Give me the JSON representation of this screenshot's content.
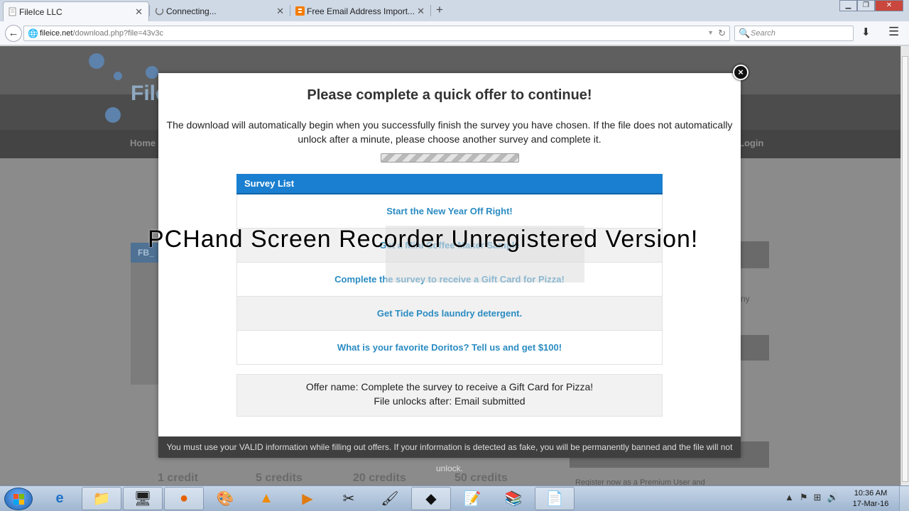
{
  "browser": {
    "tabs": [
      {
        "title": "FileIce LLC",
        "active": true
      },
      {
        "title": "Connecting...",
        "active": false
      },
      {
        "title": "Free Email Address Import...",
        "active": false
      }
    ],
    "new_tab_glyph": "+",
    "url_host": "fileice.net",
    "url_path": "/download.php?file=43v3c",
    "search_placeholder": "Search",
    "window_controls": [
      "minimize-icon",
      "restore-icon",
      "close-icon"
    ]
  },
  "page_behind": {
    "logo_text": "File",
    "nav_home": "Home",
    "nav_login": "Login",
    "tab_label": "FB_",
    "side_text": "ny",
    "register_text": "Register now as a Premium User and",
    "credits": [
      "1 credit",
      "5 credits",
      "20 credits",
      "50 credits"
    ]
  },
  "modal": {
    "title": "Please complete a quick offer to continue!",
    "description": "The download will automatically begin when you successfully finish the survey you have chosen. If the file does not automatically unlock after a minute, please choose another survey and complete it.",
    "progress_state": "indeterminate",
    "survey_list_title": "Survey List",
    "surveys": [
      "Start the New Year Off Right!",
      "Get a Mini Coffee Maker Sample",
      "Complete the survey to receive a Gift Card for Pizza!",
      "Get Tide Pods laundry detergent.",
      "What is your favorite Doritos? Tell us and get $100!"
    ],
    "offer_name_line": "Offer name: Complete the survey to receive a Gift Card for Pizza!",
    "unlock_line": "File unlocks after: Email submitted",
    "footer": "You must use your VALID information while filling out offers. If your information is detected as fake, you will be permanently banned and the file will not unlock.",
    "close_glyph": "×"
  },
  "watermark": "PCHand Screen Recorder Unregistered Version!",
  "taskbar": {
    "apps": [
      "ie-icon",
      "explorer-icon",
      "control-panel-icon",
      "firefox-icon",
      "paint-icon",
      "vlc-icon",
      "media-player-icon",
      "snipping-icon",
      "paint-brush-icon",
      "app-icon",
      "notepad-icon",
      "winrar-icon",
      "file-icon"
    ],
    "time": "10:36 AM",
    "date": "17-Mar-16"
  },
  "colors": {
    "survey_header": "#1a7fd0",
    "survey_link": "#2b8cc2",
    "modal_footer": "#3f3f3f",
    "overlay_page": "#8b8b8b"
  }
}
